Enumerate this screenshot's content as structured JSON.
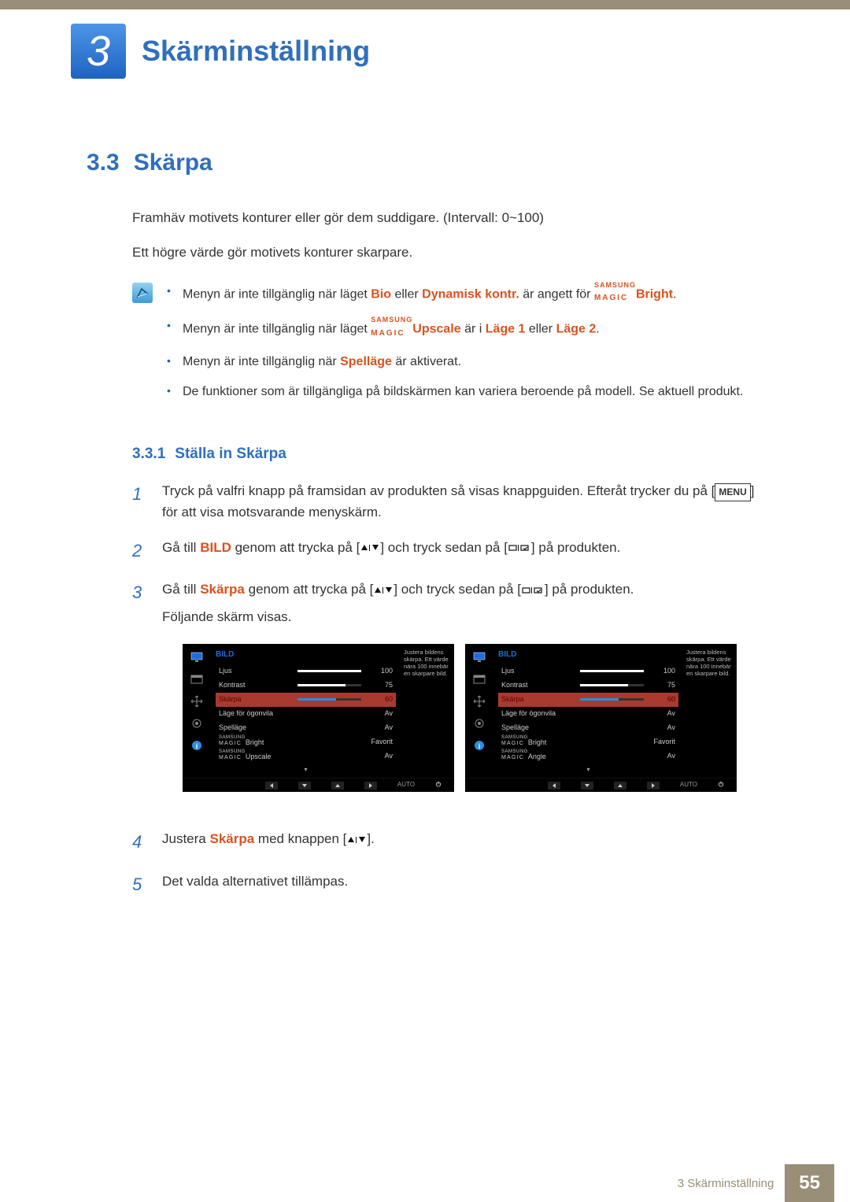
{
  "header": {
    "chapter_number": "3",
    "chapter_title": "Skärminställning"
  },
  "section": {
    "number": "3.3",
    "title": "Skärpa",
    "intro1": "Framhäv motivets konturer eller gör dem suddigare. (Intervall: 0~100)",
    "intro2": "Ett högre värde gör motivets konturer skarpare."
  },
  "notes": {
    "n1_a": "Menyn är inte tillgänglig när läget ",
    "n1_bio": "Bio",
    "n1_b": " eller ",
    "n1_dyn": "Dynamisk kontr.",
    "n1_c": " är angett för ",
    "n1_bright": "Bright",
    "n1_end": ".",
    "n2_a": "Menyn är inte tillgänglig när läget ",
    "n2_up": "Upscale",
    "n2_b": " är i ",
    "n2_l1": "Läge 1",
    "n2_c": " eller ",
    "n2_l2": "Läge 2",
    "n2_end": ".",
    "n3_a": "Menyn är inte tillgänglig när ",
    "n3_sp": "Spelläge",
    "n3_b": " är aktiverat.",
    "n4": "De funktioner som är tillgängliga på bildskärmen kan variera beroende på modell. Se aktuell produkt.",
    "magic_top": "SAMSUNG",
    "magic_bot": "MAGIC"
  },
  "subsection": {
    "number": "3.3.1",
    "title": "Ställa in Skärpa"
  },
  "steps": {
    "s1a": "Tryck på valfri knapp på framsidan av produkten så visas knappguiden. Efteråt trycker du på [",
    "s1_menu": "MENU",
    "s1b": "] för att visa motsvarande menyskärm.",
    "s2a": "Gå till ",
    "s2_bild": "BILD",
    "s2b": " genom att trycka på [",
    "s2c": "] och tryck sedan på [",
    "s2d": "] på produkten.",
    "s3a": "Gå till ",
    "s3_sk": "Skärpa",
    "s3b": " genom att trycka på [",
    "s3c": "] och tryck sedan på [",
    "s3d": "] på produkten.",
    "s3e": "Följande skärm visas.",
    "s4a": "Justera ",
    "s4_sk": "Skärpa",
    "s4b": " med knappen [",
    "s4c": "].",
    "s5": "Det valda alternativet tillämpas."
  },
  "osd": {
    "title": "BILD",
    "desc": "Justera bildens skärpa. Ett värde nära 100 innebär en skarpare bild.",
    "items": {
      "ljus": "Ljus",
      "kontrast": "Kontrast",
      "skarpa": "Skärpa",
      "ogonvila": "Läge för ögonvila",
      "spellage": "Spelläge",
      "bright": "Bright",
      "upscale": "Upscale",
      "angle": "Angle"
    },
    "vals": {
      "ljus": "100",
      "kontrast": "75",
      "skarpa": "60",
      "av": "Av",
      "favorit": "Favorit"
    },
    "auto": "AUTO",
    "magic_top": "SAMSUNG",
    "magic_bot": "MAGIC"
  },
  "footer": {
    "label": "3 Skärminställning",
    "page": "55"
  }
}
